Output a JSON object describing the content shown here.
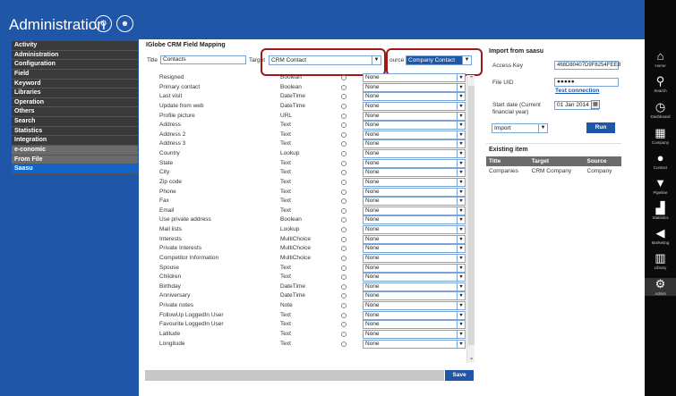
{
  "header": {
    "title": "Administration"
  },
  "nav": [
    {
      "label": "Activity",
      "style": "dark"
    },
    {
      "label": "Administration",
      "style": "dark"
    },
    {
      "label": "Configuration",
      "style": "dark"
    },
    {
      "label": "Field",
      "style": "dark"
    },
    {
      "label": "Keyword",
      "style": "dark"
    },
    {
      "label": "Libraries",
      "style": "dark"
    },
    {
      "label": "Operation",
      "style": "dark"
    },
    {
      "label": "Others",
      "style": "dark"
    },
    {
      "label": "Search",
      "style": "dark"
    },
    {
      "label": "Statistics",
      "style": "dark"
    },
    {
      "label": "Integration",
      "style": "dark"
    },
    {
      "label": "e-conomic",
      "style": "light"
    },
    {
      "label": "From File",
      "style": "light"
    },
    {
      "label": "Saasu",
      "style": "active"
    }
  ],
  "mapping": {
    "title": "IGlobe CRM Field Mapping",
    "title_label": "Title",
    "title_value": "Contacts",
    "target_label": "Target",
    "target_value": "CRM Contact",
    "source_label": "ource",
    "source_value": "Company Contact",
    "save_label": "Save",
    "rows": [
      {
        "field": "Resigned",
        "type": "Boolean",
        "select": "None"
      },
      {
        "field": "Primary contact",
        "type": "Boolean",
        "select": "None"
      },
      {
        "field": "Last visit",
        "type": "DateTime",
        "select": "None"
      },
      {
        "field": "Update from web",
        "type": "DateTime",
        "select": "None"
      },
      {
        "field": "Profile picture",
        "type": "URL",
        "select": "None"
      },
      {
        "field": "Address",
        "type": "Text",
        "select": "None"
      },
      {
        "field": "Address 2",
        "type": "Text",
        "select": "None"
      },
      {
        "field": "Address 3",
        "type": "Text",
        "select": "None"
      },
      {
        "field": "Country",
        "type": "Lookup",
        "select": "None"
      },
      {
        "field": "State",
        "type": "Text",
        "select": "None"
      },
      {
        "field": "City",
        "type": "Text",
        "select": "None"
      },
      {
        "field": "Zip code",
        "type": "Text",
        "select": "None"
      },
      {
        "field": "Phone",
        "type": "Text",
        "select": "None"
      },
      {
        "field": "Fax",
        "type": "Text",
        "select": "None"
      },
      {
        "field": "Email",
        "type": "Text",
        "select": "None"
      },
      {
        "field": "Use private address",
        "type": "Boolean",
        "select": "None"
      },
      {
        "field": "Mail lists",
        "type": "Lookup",
        "select": "None"
      },
      {
        "field": "Interests",
        "type": "MultiChoice",
        "select": "None"
      },
      {
        "field": "Private Interests",
        "type": "MultiChoice",
        "select": "None"
      },
      {
        "field": "Competitor Information",
        "type": "MultiChoice",
        "select": "None"
      },
      {
        "field": "Spouse",
        "type": "Text",
        "select": "None"
      },
      {
        "field": "Children",
        "type": "Text",
        "select": "None"
      },
      {
        "field": "Birthday",
        "type": "DateTime",
        "select": "None"
      },
      {
        "field": "Anniversary",
        "type": "DateTime",
        "select": "None"
      },
      {
        "field": "Private notes",
        "type": "Note",
        "select": "None"
      },
      {
        "field": "FollowUp LoggedIn User",
        "type": "Text",
        "select": "None"
      },
      {
        "field": "Favourite LoggedIn User",
        "type": "Text",
        "select": "None"
      },
      {
        "field": "Latitude",
        "type": "Text",
        "select": "None"
      },
      {
        "field": "Longitude",
        "type": "Text",
        "select": "None"
      }
    ]
  },
  "import": {
    "title": "Import from saasu",
    "access_key_label": "Access Key",
    "access_key_value": "468D80407D9F8254FEEB",
    "file_uid_label": "File UID",
    "file_uid_value": "●●●●●",
    "test_connection": "Test connection",
    "start_date_label": "Start date (Current financial year)",
    "start_date_value": "01 Jan 2014",
    "mode_value": "Import",
    "run_label": "Run"
  },
  "existing": {
    "title": "Existing item",
    "headers": [
      "Title",
      "Target",
      "Source"
    ],
    "rows": [
      [
        "Companies",
        "CRM Company",
        "Company"
      ]
    ]
  },
  "rightbar": [
    {
      "label": "Home",
      "icon": "home-icon",
      "glyph": "⌂"
    },
    {
      "label": "Search",
      "icon": "search-icon",
      "glyph": "⚲"
    },
    {
      "label": "Dashboard",
      "icon": "dashboard-icon",
      "glyph": "◷"
    },
    {
      "label": "Company",
      "icon": "company-icon",
      "glyph": "▦"
    },
    {
      "label": "Contact",
      "icon": "contact-icon",
      "glyph": "●"
    },
    {
      "label": "Pipeline",
      "icon": "pipeline-icon",
      "glyph": "▼"
    },
    {
      "label": "Statistics",
      "icon": "statistics-icon",
      "glyph": "▟"
    },
    {
      "label": "Marketing",
      "icon": "marketing-icon",
      "glyph": "◀"
    },
    {
      "label": "Library",
      "icon": "library-icon",
      "glyph": "▥"
    },
    {
      "label": "Admin",
      "icon": "gear-icon",
      "glyph": "⚙"
    }
  ],
  "colors": {
    "brand_blue": "#1f56a8",
    "highlight_red": "#a01818"
  }
}
